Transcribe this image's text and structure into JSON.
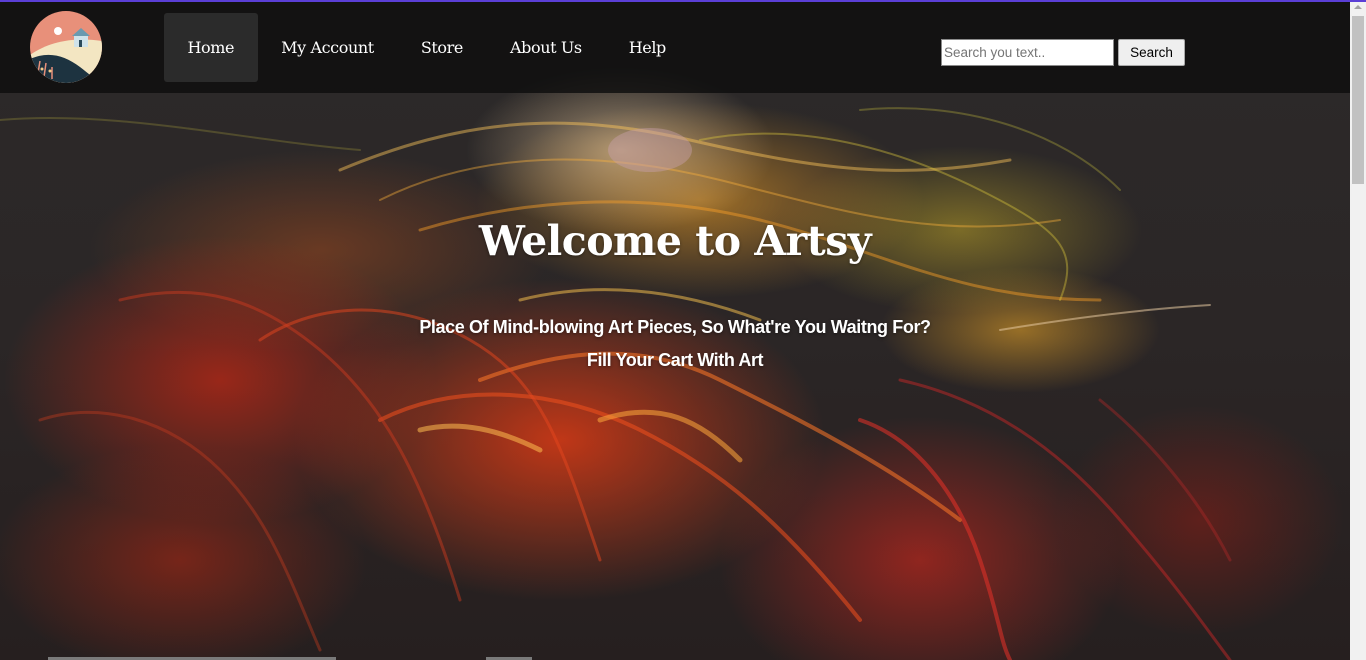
{
  "nav": {
    "logo_icon": "art-logo-icon",
    "links": [
      {
        "label": "Home",
        "active": true
      },
      {
        "label": "My Account",
        "active": false
      },
      {
        "label": "Store",
        "active": false
      },
      {
        "label": "About Us",
        "active": false
      },
      {
        "label": "Help",
        "active": false
      }
    ]
  },
  "search": {
    "placeholder": "Search you text..",
    "value": "",
    "button_label": "Search"
  },
  "hero": {
    "title": "Welcome to Artsy",
    "subtitle_line1": "Place Of Mind-blowing Art Pieces, So What're You Waitng For?",
    "subtitle_line2": "Fill Your Cart With Art",
    "background": "abstract-light-painting-fire-face"
  },
  "colors": {
    "nav_bg": "#0e0e0e",
    "nav_active_bg": "#2b2b2b",
    "accent_border": "#5b3fd6",
    "text": "#ffffff"
  }
}
